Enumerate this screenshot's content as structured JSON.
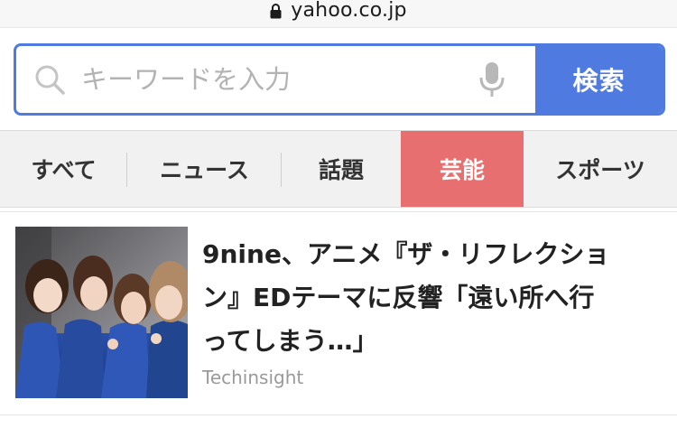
{
  "browser": {
    "url": "yahoo.co.jp",
    "lock_icon": "lock-icon"
  },
  "search": {
    "placeholder": "キーワードを入力",
    "button_label": "検索",
    "search_icon": "search-icon",
    "mic_icon": "microphone-icon",
    "accent_color": "#4f7be0"
  },
  "tabs": [
    {
      "label": "すべて",
      "active": false
    },
    {
      "label": "ニュース",
      "active": false
    },
    {
      "label": "話題",
      "active": false
    },
    {
      "label": "芸能",
      "active": true
    },
    {
      "label": "スポーツ",
      "active": false
    }
  ],
  "active_tab_color": "#e86f6f",
  "article": {
    "headline_lines": [
      "9nine、アニメ『ザ・リフレクショ",
      "ン』EDテーマに反響「遠い所へ行",
      "ってしまう…」"
    ],
    "source": "Techinsight"
  }
}
